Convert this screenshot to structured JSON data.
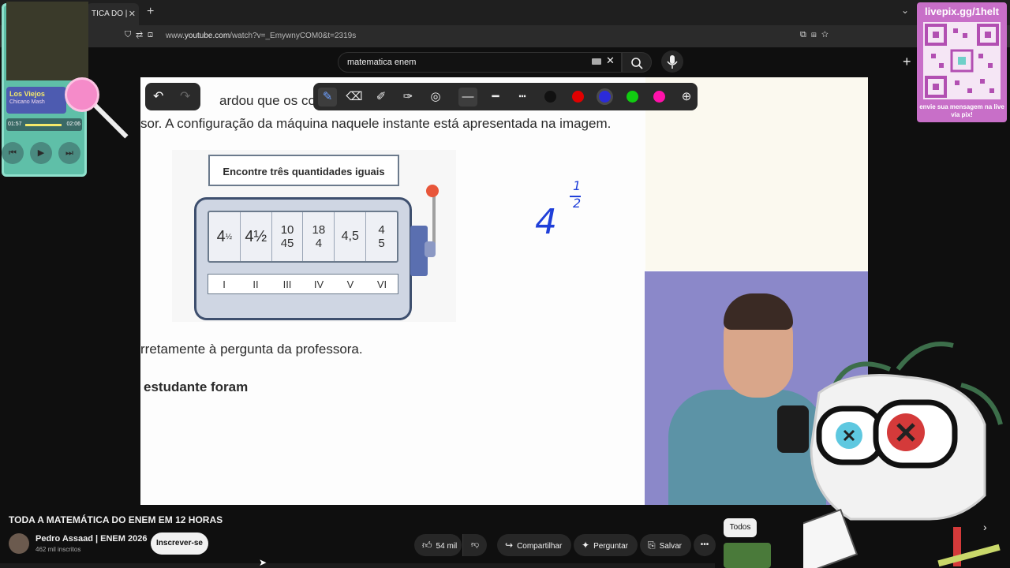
{
  "browser": {
    "tab_title": "TICA DO |",
    "url_prefix": "www.",
    "url_domain": "youtube.com",
    "url_rest": "/watch?v=_EmywnyCOM0&t=2319s"
  },
  "header": {
    "search_value": "matematica enem"
  },
  "video_content": {
    "line1": "ardou que os com",
    "line2": "sor. A configuração da máquina naquele instante está apresentada na imagem.",
    "machine_title": "Encontre três quantidades iguais",
    "reels": [
      "4½ (exp)",
      "4½",
      "10/45",
      "18/4",
      "4,5",
      "4/5"
    ],
    "numerals": [
      "I",
      "II",
      "III",
      "IV",
      "V",
      "VI"
    ],
    "line3": "rretamente à pergunta da professora.",
    "line4": "estudante foram"
  },
  "annotation_colors": [
    "#111111",
    "#e00000",
    "#2b2bd9",
    "#11cc11",
    "#ff11aa"
  ],
  "overlay": {
    "song": "Los Viejos",
    "artist": "Chicano Mash",
    "time_current": "01:57",
    "time_total": "02:06",
    "livepix_url": "livepix.gg/1helt",
    "livepix_msg": "envie sua mensagem na live via pix!"
  },
  "below": {
    "title": "TODA A MATEMÁTICA DO ENEM EM 12 HORAS",
    "channel": "Pedro Assaad | ENEM 2026",
    "subscribers": "462 mil inscritos",
    "subscribe": "Inscrever-se",
    "likes": "54 mil",
    "share": "Compartilhar",
    "ask": "Perguntar",
    "save": "Salvar",
    "chip_all": "Todos"
  }
}
